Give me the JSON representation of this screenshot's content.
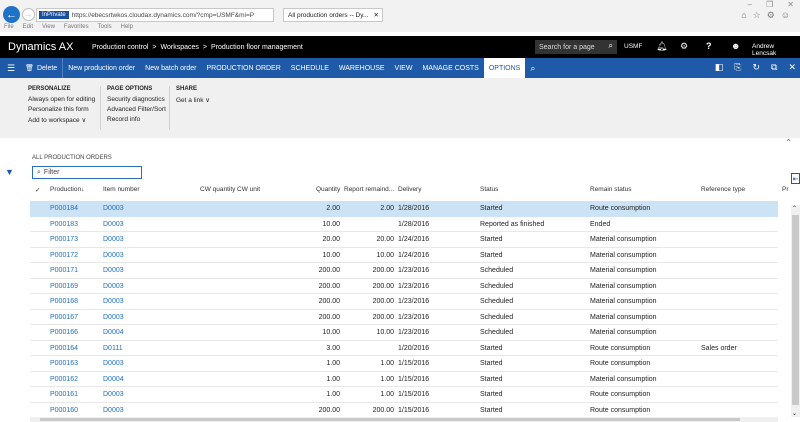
{
  "browser": {
    "inprivate": "InPrivate",
    "url": "https://ebecsrtwkos.cloudax.dynamics.com/?cmp=USMF&mi=P",
    "tab_title": "All production orders -- Dy...",
    "menu": [
      "File",
      "Edit",
      "View",
      "Favorites",
      "Tools",
      "Help"
    ]
  },
  "appbar": {
    "title": "Dynamics AX",
    "breadcrumb": [
      "Production control",
      ">",
      "Workspaces",
      ">",
      "Production floor management"
    ],
    "search_placeholder": "Search for a page",
    "company": "USMF",
    "user": "Andrew Lencsak"
  },
  "actionbar": {
    "delete": "Delete",
    "items": [
      "New production order",
      "New batch order",
      "PRODUCTION ORDER",
      "SCHEDULE",
      "WAREHOUSE",
      "VIEW",
      "MANAGE COSTS",
      "OPTIONS"
    ]
  },
  "options": {
    "personalize": {
      "title": "PERSONALIZE",
      "items": [
        "Always open for editing",
        "Personalize this form",
        "Add to workspace ∨"
      ]
    },
    "page_options": {
      "title": "PAGE OPTIONS",
      "items": [
        "Security diagnostics",
        "Advanced Filter/Sort",
        "Record info"
      ]
    },
    "share": {
      "title": "SHARE",
      "items": [
        "Get a link ∨"
      ]
    }
  },
  "grid": {
    "title": "ALL PRODUCTION ORDERS",
    "filter_placeholder": "Filter",
    "headers": {
      "production": "Production↓",
      "item": "Item number",
      "cwqty": "CW quantity",
      "cwunit": "CW unit",
      "qty": "Quantity",
      "report": "Report remaind...",
      "delivery": "Delivery",
      "status": "Status",
      "remain": "Remain status",
      "ref": "Reference type",
      "extra": "Pr"
    },
    "rows": [
      {
        "prod": "P000184",
        "item": "D0003",
        "qty": "2.00",
        "report": "2.00",
        "delivery": "1/28/2016",
        "status": "Started",
        "remain": "Route consumption",
        "ref": ""
      },
      {
        "prod": "P000183",
        "item": "D0003",
        "qty": "10.00",
        "report": "",
        "delivery": "1/28/2016",
        "status": "Reported as finished",
        "remain": "Ended",
        "ref": ""
      },
      {
        "prod": "P000173",
        "item": "D0003",
        "qty": "20.00",
        "report": "20.00",
        "delivery": "1/24/2016",
        "status": "Started",
        "remain": "Material consumption",
        "ref": ""
      },
      {
        "prod": "P000172",
        "item": "D0003",
        "qty": "10.00",
        "report": "10.00",
        "delivery": "1/24/2016",
        "status": "Started",
        "remain": "Material consumption",
        "ref": ""
      },
      {
        "prod": "P000171",
        "item": "D0003",
        "qty": "200.00",
        "report": "200.00",
        "delivery": "1/23/2016",
        "status": "Scheduled",
        "remain": "Material consumption",
        "ref": ""
      },
      {
        "prod": "P000169",
        "item": "D0003",
        "qty": "200.00",
        "report": "200.00",
        "delivery": "1/23/2016",
        "status": "Scheduled",
        "remain": "Material consumption",
        "ref": ""
      },
      {
        "prod": "P000168",
        "item": "D0003",
        "qty": "200.00",
        "report": "200.00",
        "delivery": "1/23/2016",
        "status": "Scheduled",
        "remain": "Material consumption",
        "ref": ""
      },
      {
        "prod": "P000167",
        "item": "D0003",
        "qty": "200.00",
        "report": "200.00",
        "delivery": "1/23/2016",
        "status": "Scheduled",
        "remain": "Material consumption",
        "ref": ""
      },
      {
        "prod": "P000166",
        "item": "D0004",
        "qty": "10.00",
        "report": "10.00",
        "delivery": "1/23/2016",
        "status": "Scheduled",
        "remain": "Material consumption",
        "ref": ""
      },
      {
        "prod": "P000164",
        "item": "D0111",
        "qty": "3.00",
        "report": "",
        "delivery": "1/20/2016",
        "status": "Started",
        "remain": "Route consumption",
        "ref": "Sales order"
      },
      {
        "prod": "P000163",
        "item": "D0003",
        "qty": "1.00",
        "report": "1.00",
        "delivery": "1/15/2016",
        "status": "Started",
        "remain": "Route consumption",
        "ref": ""
      },
      {
        "prod": "P000162",
        "item": "D0004",
        "qty": "1.00",
        "report": "1.00",
        "delivery": "1/15/2016",
        "status": "Started",
        "remain": "Material consumption",
        "ref": ""
      },
      {
        "prod": "P000161",
        "item": "D0003",
        "qty": "1.00",
        "report": "1.00",
        "delivery": "1/15/2016",
        "status": "Started",
        "remain": "Route consumption",
        "ref": ""
      },
      {
        "prod": "P000160",
        "item": "D0003",
        "qty": "200.00",
        "report": "200.00",
        "delivery": "1/15/2016",
        "status": "Started",
        "remain": "Route consumption",
        "ref": ""
      }
    ]
  },
  "colors": {
    "appbar": "#000000",
    "actionbar": "#1e5aa8",
    "selected_row": "#cce3f5",
    "link": "#1e6fc2"
  }
}
